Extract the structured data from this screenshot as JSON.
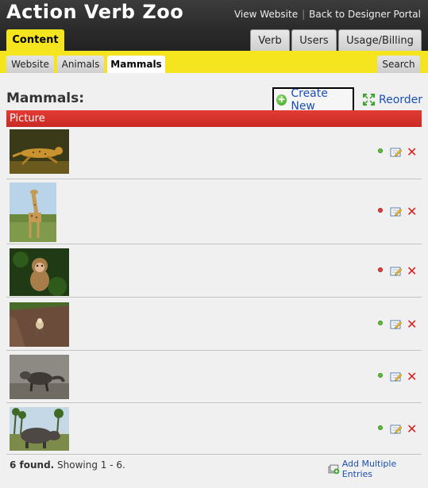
{
  "header": {
    "app_title": "Action Verb Zoo",
    "links": {
      "view_website": "View Website",
      "separator": "|",
      "back_portal": "Back to Designer Portal"
    },
    "tabs": {
      "content": "Content",
      "verb": "Verb",
      "users": "Users",
      "usage_billing": "Usage/Billing"
    }
  },
  "subnav": {
    "website": "Website",
    "animals": "Animals",
    "mammals": "Mammals",
    "search": "Search"
  },
  "main": {
    "title": "Mammals:",
    "create_new": "Create New",
    "reorder": "Reorder",
    "column_header": "Picture",
    "rows": [
      {
        "animal": "cheetah",
        "status": "green"
      },
      {
        "animal": "giraffe",
        "status": "red"
      },
      {
        "animal": "monkey",
        "status": "red"
      },
      {
        "animal": "sloth",
        "status": "green"
      },
      {
        "animal": "mongoose",
        "status": "green"
      },
      {
        "animal": "rhinoceros",
        "status": "green"
      }
    ],
    "footer": {
      "found": "6 found.",
      "showing": " Showing 1 - 6.",
      "add_multiple": "Add Multiple Entries"
    }
  },
  "colors": {
    "header_bg": "#2a2a2a",
    "accent_yellow": "#f5e51f",
    "column_header_red": "#d1312b",
    "link_blue": "#1a4fb5",
    "status_green": "#5fbf3a",
    "status_red": "#e64040"
  }
}
